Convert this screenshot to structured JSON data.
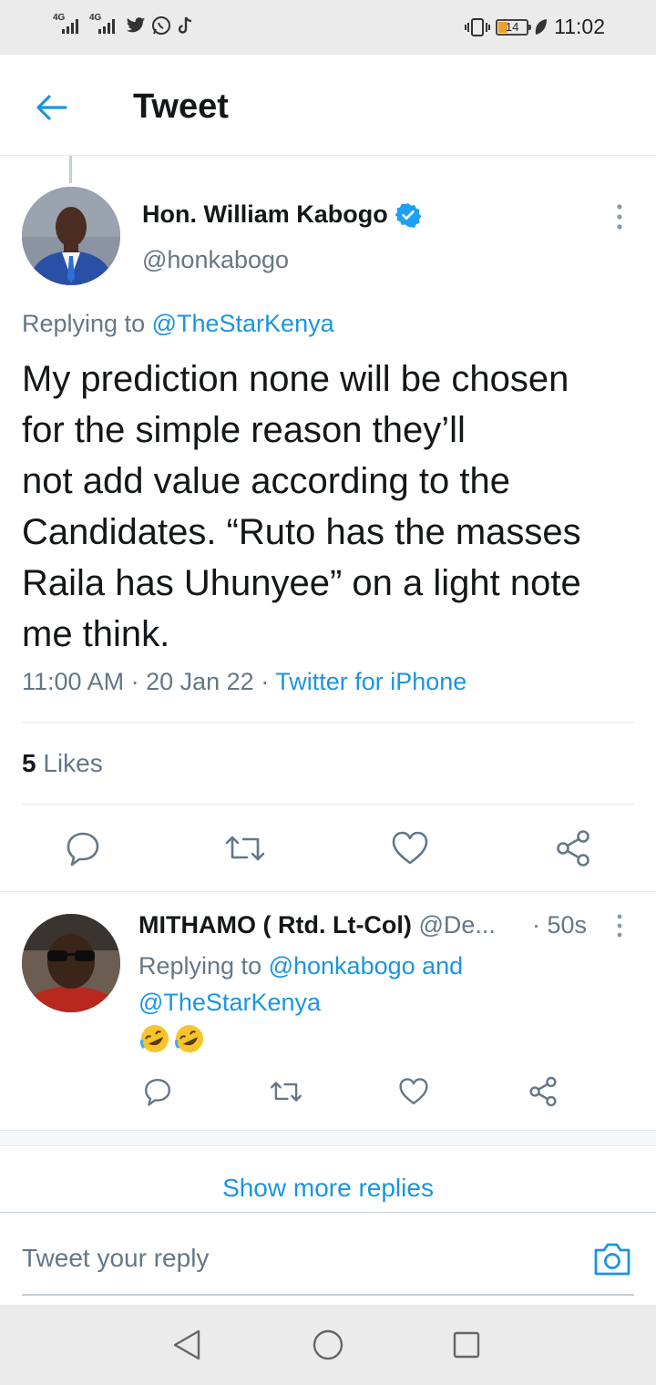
{
  "status_bar": {
    "signal_label_1": "4G",
    "signal_label_2": "4G",
    "battery_level": "14",
    "time": "11:02"
  },
  "header": {
    "title": "Tweet"
  },
  "tweet": {
    "author_name": "Hon. William Kabogo",
    "author_handle": "@honkabogo",
    "replying_prefix": "Replying to ",
    "replying_to": "@TheStarKenya",
    "text": "My prediction none will be chosen\nfor the simple reason they’ll\nnot add value according to the\nCandidates. “Ruto has the masses\nRaila has Uhunyee” on a light note\nme think.",
    "time": "11:00 AM",
    "date": "20 Jan 22",
    "separator": " · ",
    "source": "Twitter for iPhone",
    "likes_count": "5",
    "likes_label": "Likes"
  },
  "reply": {
    "author_name": "MITHAMO ( Rtd. Lt-Col)",
    "author_handle": "@De...",
    "time": "· 50s",
    "replying_prefix": "Replying to ",
    "replying_to_1": "@honkabogo",
    "replying_and": " and",
    "replying_to_2": "@TheStarKenya",
    "text": "🤣🤣"
  },
  "show_more_replies": "Show more replies",
  "reply_input": {
    "placeholder": "Tweet your reply"
  },
  "colors": {
    "accent": "#1b95e0",
    "secondary_text": "#657786",
    "border": "#e1e8ed"
  },
  "icons": [
    "back-arrow-icon",
    "verified-icon",
    "more-icon",
    "reply-icon",
    "retweet-icon",
    "like-icon",
    "share-icon",
    "camera-icon",
    "nav-back-icon",
    "nav-home-icon",
    "nav-recents-icon"
  ]
}
